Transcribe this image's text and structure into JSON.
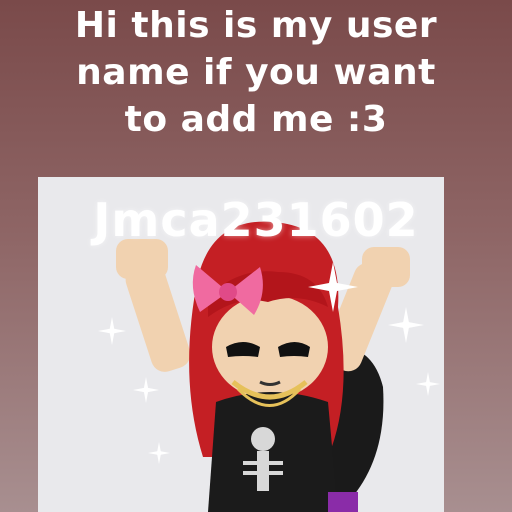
{
  "caption": {
    "line1": "Hi this is my user",
    "line2": "name if you want",
    "line3": "to add me :3"
  },
  "username": "Jmca231602",
  "colors": {
    "background_top": "#7a4a4a",
    "background_bottom": "#a88f90",
    "text": "#ffffff",
    "photo_background": "#e9e9ec",
    "hair": "#c41f24",
    "bow": "#f06aa0",
    "skin": "#f1d2b0"
  },
  "icons": [
    "sparkle-icon",
    "bow-icon"
  ]
}
